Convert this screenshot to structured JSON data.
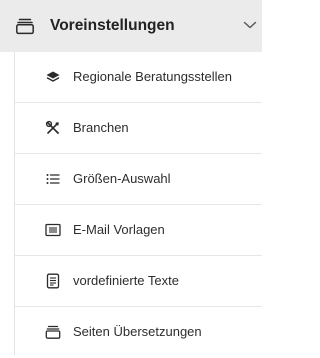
{
  "menu": {
    "header": {
      "label": "Voreinstellungen",
      "icon": "window-stack-icon",
      "expanded": true
    },
    "items": [
      {
        "label": "Regionale Beratungsstellen",
        "icon": "layers-icon"
      },
      {
        "label": "Branchen",
        "icon": "tools-icon"
      },
      {
        "label": "Größen-Auswahl",
        "icon": "list-icon"
      },
      {
        "label": "E-Mail Vorlagen",
        "icon": "email-template-icon"
      },
      {
        "label": "vordefinierte Texte",
        "icon": "text-document-icon"
      },
      {
        "label": "Seiten Übersetzungen",
        "icon": "window-stack-icon"
      }
    ]
  }
}
